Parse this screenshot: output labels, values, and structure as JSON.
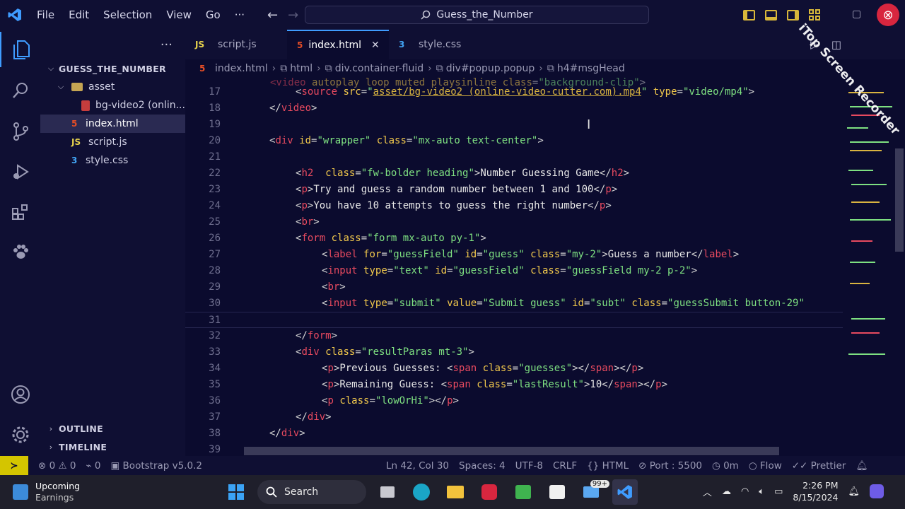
{
  "menu": [
    "File",
    "Edit",
    "Selection",
    "View",
    "Go"
  ],
  "menu_more": "···",
  "command_center": "Guess_the_Number",
  "sidebar": {
    "more": "···",
    "root": "GUESS_THE_NUMBER",
    "folder": "asset",
    "asset_file": "bg-video2 (onlin...",
    "files": [
      {
        "name": "index.html",
        "icon": "5"
      },
      {
        "name": "script.js",
        "icon": "JS"
      },
      {
        "name": "style.css",
        "icon": "3"
      }
    ],
    "outline": "OUTLINE",
    "timeline": "TIMELINE"
  },
  "tabs": [
    {
      "label": "script.js",
      "icon": "JS"
    },
    {
      "label": "index.html",
      "icon": "5"
    },
    {
      "label": "style.css",
      "icon": "3"
    }
  ],
  "tab_close": "✕",
  "breadcrumb": [
    "index.html",
    "html",
    "div.container-fluid",
    "div#popup.popup",
    "h4#msgHead"
  ],
  "line_numbers": [
    "17",
    "18",
    "19",
    "20",
    "21",
    "22",
    "23",
    "24",
    "25",
    "26",
    "27",
    "28",
    "29",
    "30",
    "31",
    "32",
    "33",
    "34",
    "35",
    "36",
    "37",
    "38",
    "39"
  ],
  "status": {
    "errors": "0",
    "warnings": "0",
    "ports": "0",
    "bootstrap": "Bootstrap v5.0.2",
    "position": "Ln 42, Col 30",
    "spaces": "Spaces: 4",
    "encoding": "UTF-8",
    "eol": "CRLF",
    "language": "HTML",
    "port": "Port : 5500",
    "time": "0m",
    "flow": "Flow",
    "prettier": "Prettier"
  },
  "taskbar": {
    "weather_title": "Upcoming",
    "weather_sub": "Earnings",
    "search": "Search",
    "mail_badge": "99+",
    "time": "2:26 PM",
    "date": "8/15/2024"
  },
  "watermark": "iTop Screen Recorder",
  "colors": {
    "background": "#0b0b2e",
    "tag": "#e84a5f",
    "attribute": "#f2c94c",
    "string": "#7ee081",
    "accent": "#3f9cff"
  }
}
